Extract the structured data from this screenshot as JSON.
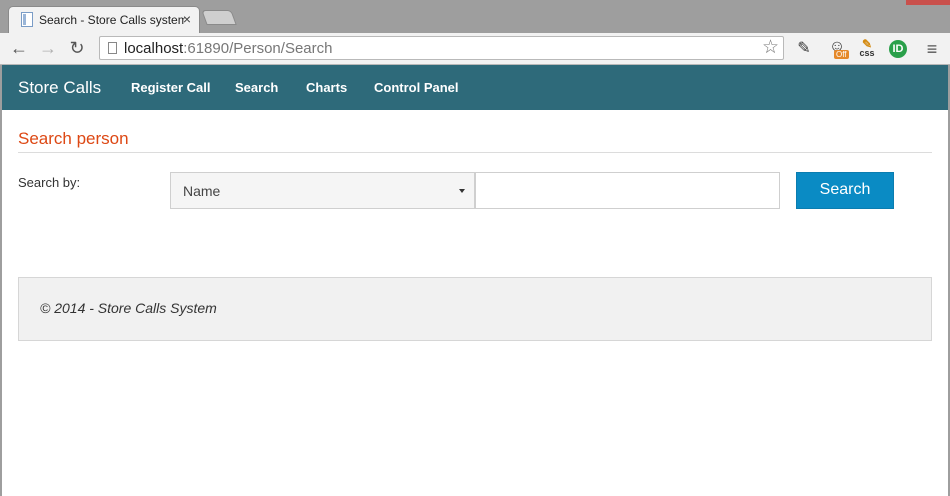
{
  "browser": {
    "tab_title": "Search - Store Calls system",
    "close_symbol": "×",
    "url_host": "localhost",
    "url_rest": ":61890/Person/Search",
    "nav": {
      "back_symbol": "←",
      "forward_symbol": "→",
      "reload_symbol": "↻",
      "bookmark_symbol": "☆",
      "menu_symbol": "≡"
    },
    "extensions": {
      "dropper_symbol": "✎",
      "cat_badge": "Off",
      "css_label": "css",
      "ideas_label": "ID"
    }
  },
  "navbar": {
    "brand": "Store Calls",
    "items": [
      {
        "label": "Register Call"
      },
      {
        "label": "Search"
      },
      {
        "label": "Charts"
      },
      {
        "label": "Control Panel"
      }
    ],
    "background_color": "#2e6a7a"
  },
  "main": {
    "heading": "Search person",
    "heading_color": "#dd4814",
    "search_label": "Search by:",
    "search_by": {
      "selected": "Name"
    },
    "search_input": {
      "value": "",
      "placeholder": ""
    },
    "search_button_label": "Search",
    "button_color": "#0a8bc4"
  },
  "footer": {
    "copyright": "© 2014 - Store Calls System"
  },
  "icons": {
    "favicon": "page-icon",
    "bookmark": "star-icon",
    "dropper": "eyedropper-icon",
    "cat": "cat-extension-icon",
    "css": "css-editor-icon",
    "ideas": "ideas-extension-icon",
    "menu": "hamburger-menu-icon"
  }
}
